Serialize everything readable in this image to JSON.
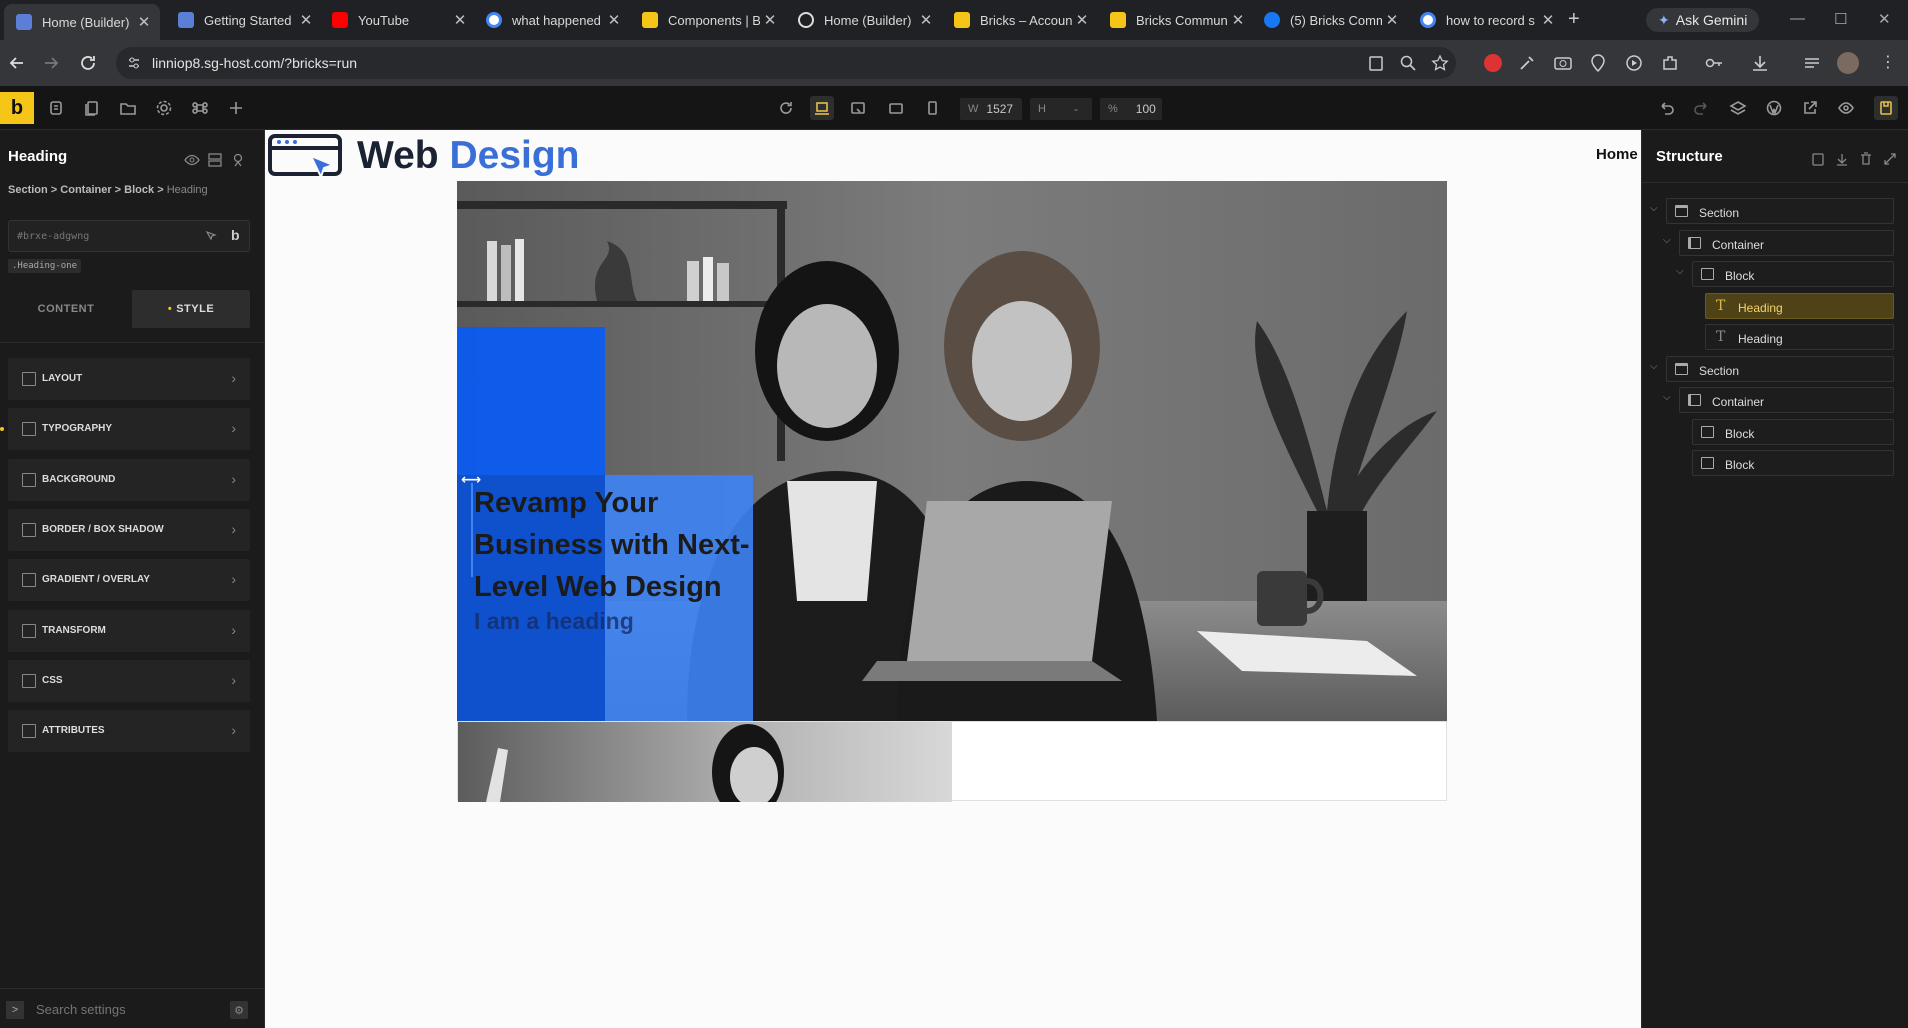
{
  "browser": {
    "tabs": [
      {
        "title": "Home (Builder)",
        "favicon": "bricks",
        "color": "#5b7fd6",
        "active": true
      },
      {
        "title": "Getting Started",
        "favicon": "bricks",
        "color": "#5b7fd6"
      },
      {
        "title": "YouTube",
        "favicon": "youtube",
        "color": "#ff0000"
      },
      {
        "title": "what happened",
        "favicon": "google",
        "color": "#ffffff"
      },
      {
        "title": "Components | B",
        "favicon": "bricks-b",
        "color": "#f5c518"
      },
      {
        "title": "Home (Builder)",
        "favicon": "wordpress",
        "color": "#dddddd"
      },
      {
        "title": "Bricks – Accoun",
        "favicon": "bricks-b",
        "color": "#f5c518"
      },
      {
        "title": "Bricks Commun",
        "favicon": "bricks-b",
        "color": "#f5c518"
      },
      {
        "title": "(5) Bricks Comm",
        "favicon": "facebook",
        "color": "#1877f2"
      },
      {
        "title": "how to record s",
        "favicon": "google",
        "color": "#ffffff"
      }
    ],
    "new_tab": "+",
    "ask_gemini": "Ask Gemini",
    "url": "linniop8.sg-host.com/?bricks=run"
  },
  "toolbar": {
    "logo": "b",
    "width_label": "W",
    "width_value": "1527",
    "height_label": "H",
    "height_value": "-",
    "zoom_label": "%",
    "zoom_value": "100"
  },
  "left_panel": {
    "title": "Heading",
    "breadcrumb": [
      "Section",
      "Container",
      "Block"
    ],
    "breadcrumb_current": "Heading",
    "sep": " > ",
    "id_value": "#brxe-adgwng",
    "class_tag": ".Heading-one",
    "tab_content": "CONTENT",
    "tab_style": "STYLE",
    "sections": [
      "LAYOUT",
      "TYPOGRAPHY",
      "BACKGROUND",
      "BORDER / BOX SHADOW",
      "GRADIENT / OVERLAY",
      "TRANSFORM",
      "CSS",
      "ATTRIBUTES"
    ],
    "search_placeholder": "Search settings",
    "colors": {
      "accent": "#f5c518"
    }
  },
  "canvas": {
    "logo_word1": "Web",
    "logo_word2": "Design",
    "nav_home": "Home",
    "hero_heading": "Revamp Your Business with Next-Level Web Design",
    "hero_sub": "I am a heading",
    "colors": {
      "blue_block": "#0a5cf0",
      "blue_card": "#3d84f5"
    }
  },
  "right_panel": {
    "title": "Structure",
    "tree": [
      {
        "label": "Section",
        "depth": 0,
        "type": "section"
      },
      {
        "label": "Container",
        "depth": 1,
        "type": "container"
      },
      {
        "label": "Block",
        "depth": 2,
        "type": "block"
      },
      {
        "label": "Heading",
        "depth": 3,
        "type": "text",
        "selected": true
      },
      {
        "label": "Heading",
        "depth": 3,
        "type": "text"
      },
      {
        "label": "Section",
        "depth": 0,
        "type": "section"
      },
      {
        "label": "Container",
        "depth": 1,
        "type": "container"
      },
      {
        "label": "Block",
        "depth": 2,
        "type": "block"
      },
      {
        "label": "Block",
        "depth": 2,
        "type": "block"
      }
    ]
  }
}
